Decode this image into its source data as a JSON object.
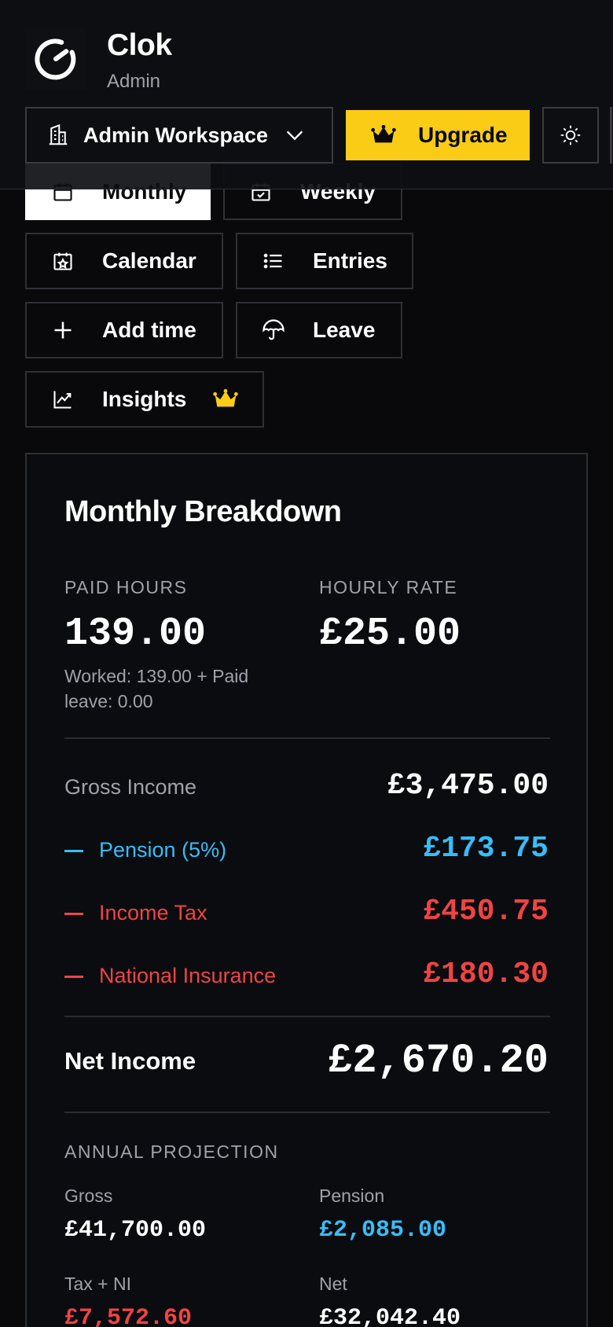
{
  "app": {
    "title": "Clok",
    "role": "Admin"
  },
  "header": {
    "workspace_label": "Admin Workspace",
    "upgrade_label": "Upgrade"
  },
  "nav": {
    "monthly": "Monthly",
    "weekly": "Weekly",
    "calendar": "Calendar",
    "entries": "Entries",
    "add_time": "Add time",
    "leave": "Leave",
    "insights": "Insights"
  },
  "icons": {
    "logo": "clock-logo-icon",
    "workspace": "building-icon",
    "chevron": "chevron-down-icon",
    "crown": "crown-icon",
    "theme": "sun-icon",
    "monthly": "calendar-icon",
    "weekly": "calendar-check-icon",
    "calendar": "calendar-star-icon",
    "entries": "list-icon",
    "add_time": "plus-icon",
    "leave": "umbrella-icon",
    "insights": "trend-chart-icon"
  },
  "colors": {
    "accent": "#facc15",
    "pension": "#38bdf8",
    "deduction": "#ef4444",
    "muted": "#a1a1aa"
  },
  "breakdown": {
    "title": "Monthly Breakdown",
    "paid_hours_label": "PAID HOURS",
    "paid_hours_value": "139.00",
    "paid_hours_note": "Worked: 139.00 + Paid leave: 0.00",
    "hourly_rate_label": "HOURLY RATE",
    "hourly_rate_value": "£25.00",
    "gross_label": "Gross Income",
    "gross_value": "£3,475.00",
    "pension_label": "Pension (5%)",
    "pension_value": "£173.75",
    "tax_label": "Income Tax",
    "tax_value": "£450.75",
    "ni_label": "National Insurance",
    "ni_value": "£180.30",
    "net_label": "Net Income",
    "net_value": "£2,670.20"
  },
  "projection": {
    "title": "ANNUAL PROJECTION",
    "gross_label": "Gross",
    "gross_value": "£41,700.00",
    "pension_label": "Pension",
    "pension_value": "£2,085.00",
    "taxni_label": "Tax + NI",
    "taxni_value": "£7,572.60",
    "net_label": "Net",
    "net_value": "£32,042.40"
  }
}
